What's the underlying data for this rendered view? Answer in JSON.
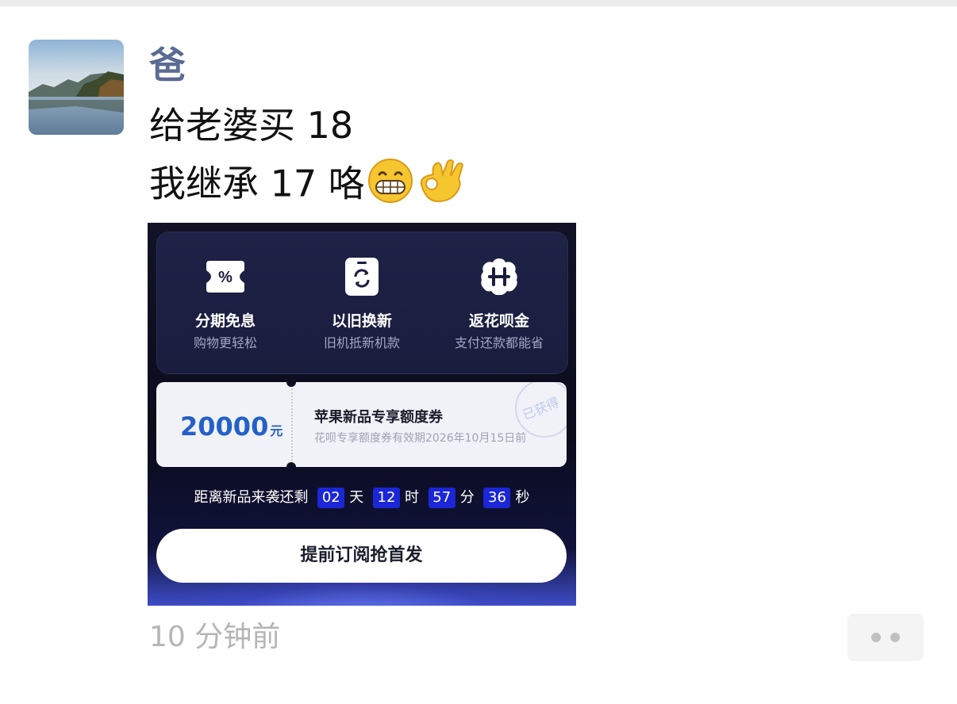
{
  "post": {
    "author": "爸",
    "line1": "给老婆买 18",
    "line2": "我继承 17 咯",
    "emojis": [
      "grin-emoji",
      "ok-hand-emoji"
    ],
    "timestamp": "10 分钟前"
  },
  "shared_image": {
    "benefits": [
      {
        "icon": "percent-ticket-icon",
        "title": "分期免息",
        "subtitle": "购物更轻松"
      },
      {
        "icon": "phone-refresh-icon",
        "title": "以旧换新",
        "subtitle": "旧机抵新机款"
      },
      {
        "icon": "huabei-h-icon",
        "title": "返花呗金",
        "subtitle": "支付还款都能省"
      }
    ],
    "coupon": {
      "amount": "20000",
      "unit": "元",
      "title": "苹果新品专享额度券",
      "subtitle": "花呗专享额度券有效期2026年10月15日前",
      "stamp": "已获得"
    },
    "countdown": {
      "prefix": "距离新品来袭还剩",
      "days": "02",
      "days_label": "天",
      "hours": "12",
      "hours_label": "时",
      "minutes": "57",
      "minutes_label": "分",
      "seconds": "36",
      "seconds_label": "秒"
    },
    "cta": "提前订阅抢首发"
  },
  "colors": {
    "author": "#5b6b93",
    "coupon_amount": "#2460c8",
    "countdown_box": "#1b26d6"
  }
}
